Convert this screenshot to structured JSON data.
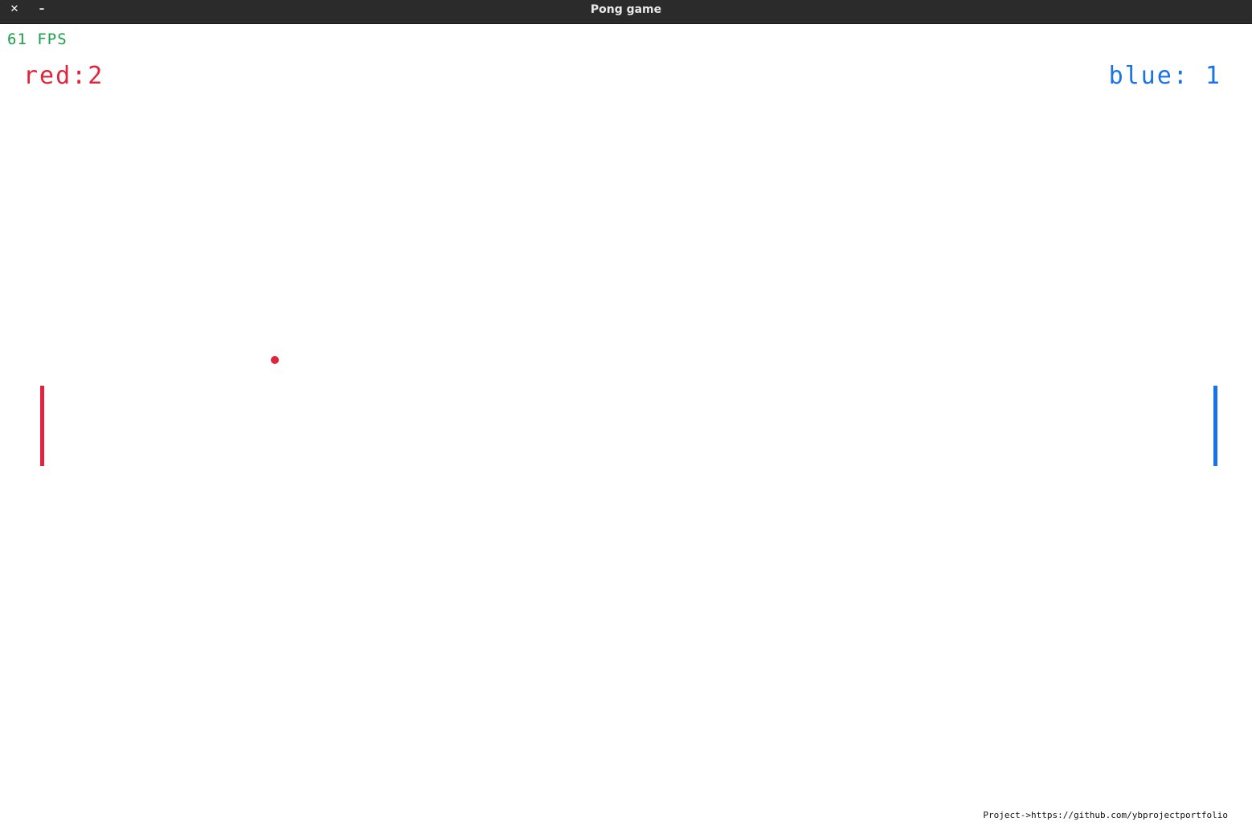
{
  "window": {
    "title": "Pong game",
    "close_label": "✕",
    "minimize_label": "–"
  },
  "hud": {
    "fps": "61 FPS",
    "fps_color": "#1aa04a",
    "red_score_label": "red:2",
    "blue_score_label": "blue: 1"
  },
  "colors": {
    "red": "#e0243c",
    "blue": "#1a73e8",
    "background": "#ffffff"
  },
  "footer": {
    "credit": "Project->https://github.com/ybprojectportfolio"
  }
}
